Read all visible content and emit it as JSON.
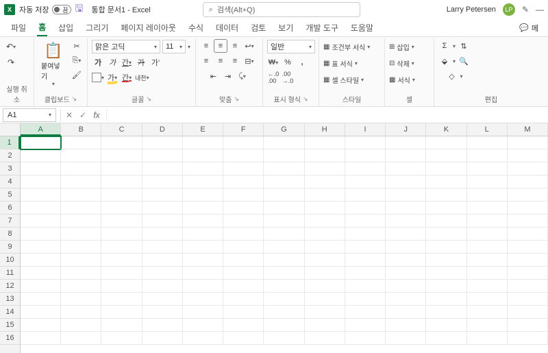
{
  "titlebar": {
    "autosave_label": "자동 저장",
    "autosave_state": "끔",
    "doc_title": "통합 문서1 - Excel",
    "search_placeholder": "검색(Alt+Q)",
    "user_name": "Larry Petersen",
    "user_initials": "LP"
  },
  "tabs": {
    "items": [
      "파일",
      "홈",
      "삽입",
      "그리기",
      "페이지 레이아웃",
      "수식",
      "데이터",
      "검토",
      "보기",
      "개발 도구",
      "도움말"
    ],
    "active_index": 1,
    "comment_btn": "메"
  },
  "ribbon": {
    "undo_group": "실행 취소",
    "clipboard": {
      "paste": "붙여넣기",
      "label": "클립보드"
    },
    "font": {
      "name": "맑은 고딕",
      "size": "11",
      "bold": "가",
      "italic": "가",
      "underline": "간",
      "strike": "가",
      "superscript": "가'",
      "border": "⊞",
      "fill": "가",
      "color": "간",
      "phonetic": "내천",
      "label": "글꼴"
    },
    "align": {
      "label": "맞춤",
      "wrap": "↩",
      "merge": "⊟"
    },
    "number": {
      "format": "일반",
      "currency": "₩",
      "percent": "%",
      "comma": ",",
      "inc": "←.0",
      "dec": ".00→",
      "label": "표시 형식"
    },
    "styles": {
      "cond": "조건부 서식",
      "table": "표 서식",
      "cell": "셀 스타일",
      "label": "스타일"
    },
    "cells": {
      "insert": "삽입",
      "delete": "삭제",
      "format": "서식",
      "label": "셀"
    },
    "editing": {
      "sum": "Σ",
      "fill": "⬙",
      "clear": "◇",
      "label": "편집"
    }
  },
  "formula_bar": {
    "name_box": "A1"
  },
  "grid": {
    "columns": [
      "A",
      "B",
      "C",
      "D",
      "E",
      "F",
      "G",
      "H",
      "I",
      "J",
      "K",
      "L",
      "M"
    ],
    "rows": [
      "1",
      "2",
      "3",
      "4",
      "5",
      "6",
      "7",
      "8",
      "9",
      "10",
      "11",
      "12",
      "13",
      "14",
      "15",
      "16"
    ],
    "active_cell": "A1"
  }
}
